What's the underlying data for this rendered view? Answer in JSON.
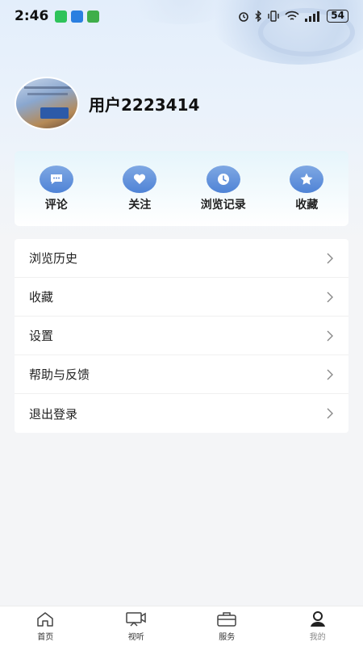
{
  "status_bar": {
    "time": "2:46",
    "battery": "54"
  },
  "profile": {
    "username": "用户2223414"
  },
  "quick_actions": [
    {
      "label": "评论",
      "icon": "comment-icon"
    },
    {
      "label": "关注",
      "icon": "heart-icon"
    },
    {
      "label": "浏览记录",
      "icon": "clock-icon"
    },
    {
      "label": "收藏",
      "icon": "star-icon"
    }
  ],
  "menu": [
    {
      "label": "浏览历史"
    },
    {
      "label": "收藏"
    },
    {
      "label": "设置"
    },
    {
      "label": "帮助与反馈"
    },
    {
      "label": "退出登录"
    }
  ],
  "bottom_nav": [
    {
      "label": "首页",
      "icon": "home-icon"
    },
    {
      "label": "视听",
      "icon": "tv-icon"
    },
    {
      "label": "服务",
      "icon": "briefcase-icon"
    },
    {
      "label": "我的",
      "icon": "user-icon",
      "active": true
    }
  ],
  "colors": {
    "accent": "#4f83d6",
    "active_nav": "#222222"
  }
}
